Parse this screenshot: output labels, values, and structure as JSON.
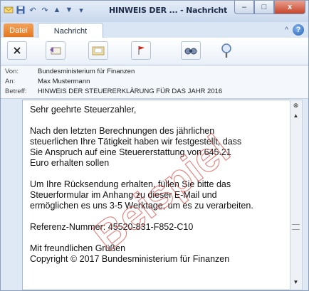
{
  "window": {
    "title": "HINWEIS DER ... - Nachricht",
    "minimize_glyph": "–",
    "maximize_glyph": "□",
    "close_glyph": "x"
  },
  "quick_access": {
    "items": [
      "mail-icon",
      "save-icon",
      "undo-icon",
      "redo-icon",
      "up-icon",
      "down-icon",
      "customize-icon"
    ]
  },
  "tabs": {
    "file": "Datei",
    "message": "Nachricht",
    "collapse_glyph": "^",
    "help_glyph": "?"
  },
  "ribbon": {
    "buttons": [
      "delete-icon",
      "reply-icon",
      "move-icon",
      "flag-icon",
      "find-icon",
      "zoom-icon"
    ]
  },
  "headers": {
    "from_label": "Von:",
    "from_value": "Bundesministerium für Finanzen",
    "to_label": "An:",
    "to_value": "Max Mustermann",
    "subject_label": "Betreff:",
    "subject_value": "HINWEIS DER STEUERERKLÄRUNG FÜR DAS JAHR 2016"
  },
  "body": {
    "greeting": "Sehr geehrte Steuerzahler,",
    "p1_l1": "Nach den letzten Berechnungen des jährlichen",
    "p1_l2": "steuerlichen Ihre Tätigkeit haben wir festgestellt, dass",
    "p1_l3": "Sie Anspruch auf eine Steuererstattung von  645.21",
    "p1_l4": "Euro erhalten sollen",
    "p2_l1": "Um Ihre Rücksendung erhalten, füllen Sie bitte das",
    "p2_l2": "Steuerformular im Anhang zu dieser E-Mail und",
    "p2_l3": "ermöglichen es uns 3-5 Werktage, um es zu verarbeiten.",
    "reference": "Referenz-Nummer: 45520-831-F852-C10",
    "closing": "Mit freundlichen Grüßen",
    "copyright": "Copyright © 2017 Bundesministerium  für Finanzen"
  },
  "watermark": "Beispiel",
  "colors": {
    "file_tab": "#e4761d",
    "close_button": "#c7442a",
    "watermark": "#d9534f"
  }
}
